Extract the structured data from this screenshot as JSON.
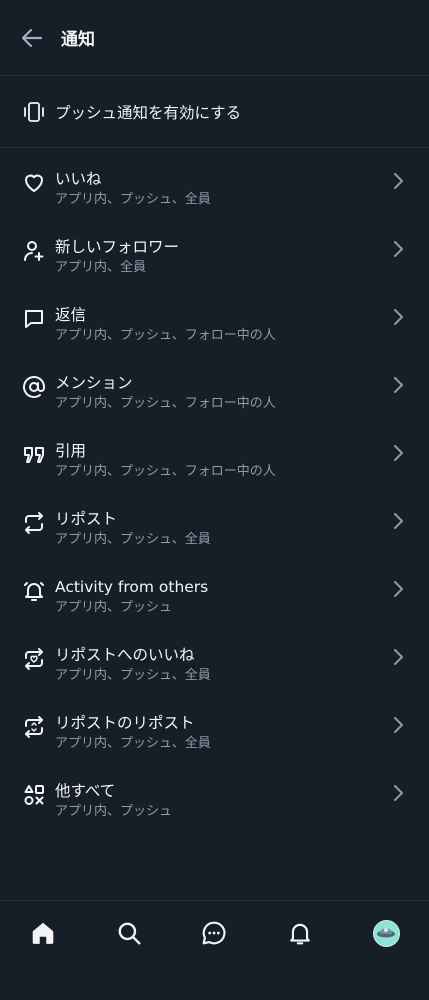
{
  "header": {
    "title": "通知",
    "back_icon": "arrow-left-icon"
  },
  "push": {
    "label": "プッシュ通知を有効にする",
    "icon": "phone-vibrate-icon"
  },
  "items": [
    {
      "title": "いいね",
      "sub": "アプリ内、プッシュ、全員",
      "icon": "heart-icon"
    },
    {
      "title": "新しいフォロワー",
      "sub": "アプリ内、全員",
      "icon": "person-plus-icon"
    },
    {
      "title": "返信",
      "sub": "アプリ内、プッシュ、フォロー中の人",
      "icon": "speech-bubble-icon"
    },
    {
      "title": "メンション",
      "sub": "アプリ内、プッシュ、フォロー中の人",
      "icon": "at-sign-icon"
    },
    {
      "title": "引用",
      "sub": "アプリ内、プッシュ、フォロー中の人",
      "icon": "quote-icon"
    },
    {
      "title": "リポスト",
      "sub": "アプリ内、プッシュ、全員",
      "icon": "repost-icon"
    },
    {
      "title": "Activity from others",
      "sub": "アプリ内、プッシュ",
      "icon": "bell-ringing-icon"
    },
    {
      "title": "リポストへのいいね",
      "sub": "アプリ内、プッシュ、全員",
      "icon": "repost-heart-icon"
    },
    {
      "title": "リポストのリポスト",
      "sub": "アプリ内、プッシュ、全員",
      "icon": "repost-repost-icon"
    },
    {
      "title": "他すべて",
      "sub": "アプリ内、プッシュ",
      "icon": "shapes-icon"
    }
  ],
  "tabbar": {
    "tabs": [
      {
        "name": "home",
        "icon": "home-icon"
      },
      {
        "name": "search",
        "icon": "search-icon"
      },
      {
        "name": "chat",
        "icon": "chat-bubble-icon"
      },
      {
        "name": "notifications",
        "icon": "bell-icon"
      },
      {
        "name": "profile",
        "icon": "avatar-icon"
      }
    ]
  },
  "colors": {
    "background": "#161e27",
    "text_primary": "#f1f3f5",
    "text_secondary": "#8e9aa6",
    "divider": "#232e3a",
    "chevron": "#8e9aa6"
  }
}
